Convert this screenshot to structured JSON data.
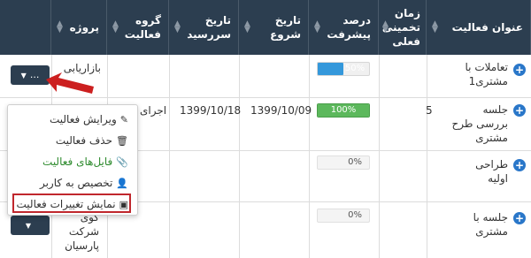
{
  "columns": [
    {
      "key": "activity_title",
      "label_lines": [
        "عنوان فعالیت"
      ]
    },
    {
      "key": "estimated_time",
      "label_lines": [
        "زمان",
        "تخمینی",
        "فعلی"
      ]
    },
    {
      "key": "progress",
      "label_lines": [
        "درصد",
        "پیشرفت"
      ]
    },
    {
      "key": "start_date",
      "label_lines": [
        "تاریخ",
        "شروع"
      ]
    },
    {
      "key": "due_date",
      "label_lines": [
        "تاریخ",
        "سررسید"
      ]
    },
    {
      "key": "group",
      "label_lines": [
        "گروه",
        "فعالیت"
      ]
    },
    {
      "key": "project",
      "label_lines": [
        "پروژه"
      ]
    }
  ],
  "rows": [
    {
      "title_lines": [
        "تعاملات با",
        "مشتری1"
      ],
      "estimated_time": "",
      "progress": 50,
      "progress_label": "50%",
      "progress_color": "#3498db",
      "start_date": "",
      "due_date": "",
      "group": "",
      "project": "بازاریابی",
      "action_label": "..."
    },
    {
      "title_lines": [
        "جلسه",
        "بررسی طرح",
        "مشتری"
      ],
      "estimated_time": "5",
      "progress": 100,
      "progress_label": "100%",
      "progress_color": "#5cb85c",
      "start_date": "1399/10/09",
      "due_date": "1399/10/18",
      "group": "اجرای",
      "project": "",
      "action_label": ""
    },
    {
      "title_lines": [
        "طراحی",
        "اولیه"
      ],
      "estimated_time": "",
      "progress": 0,
      "progress_label": "0%",
      "progress_color": "",
      "start_date": "",
      "due_date": "",
      "group": "",
      "project": "",
      "action_label": ""
    },
    {
      "title_lines": [
        "جلسه با",
        "مشتری"
      ],
      "estimated_time": "",
      "progress": 0,
      "progress_label": "0%",
      "progress_color": "",
      "start_date": "",
      "due_date": "",
      "group": "",
      "project_lines": [
        "کوی",
        "شرکت",
        "پارسیان"
      ],
      "action_label": ""
    }
  ],
  "dropdown": {
    "items": [
      {
        "label": "ویرایش فعالیت",
        "icon": "edit-icon",
        "color": "#333333"
      },
      {
        "label": "حذف فعالیت",
        "icon": "trash-icon",
        "color": "#333333"
      },
      {
        "label": "فایل‌های فعالیت",
        "icon": "paperclip-icon",
        "color": "#2e8b2e"
      },
      {
        "label": "تخصیص به کاربر",
        "icon": "user-plus-icon",
        "color": "#333333"
      },
      {
        "label": "نمایش تغییرات فعالیت",
        "icon": "archive-icon",
        "color": "#333333"
      }
    ]
  },
  "colors": {
    "header_bg": "#2c3e50",
    "accent_blue": "#2a77c9",
    "highlight_red": "#c0272d",
    "arrow_red": "#cc1f1f"
  }
}
